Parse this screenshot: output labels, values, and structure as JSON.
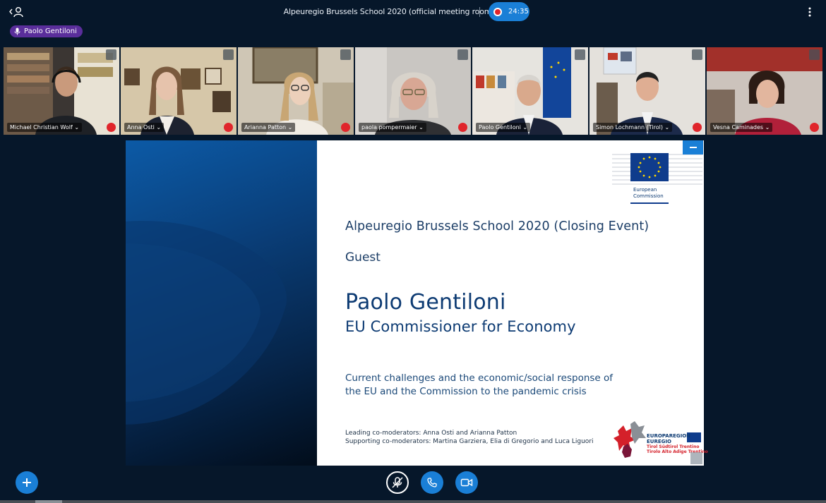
{
  "meeting": {
    "title": "Alpeuregio Brussels School 2020 (official meeting room)",
    "recording_time": "24:35"
  },
  "talking": {
    "speaker": "Paolo Gentiloni"
  },
  "webcams": [
    {
      "name": "Michael Christian Wolf ⌄",
      "muted": true,
      "active": false
    },
    {
      "name": "Anna Osti ⌄",
      "muted": true,
      "active": false
    },
    {
      "name": "Arianna Patton ⌄",
      "muted": true,
      "active": false
    },
    {
      "name": "paola pompermaier ⌄",
      "muted": true,
      "active": false
    },
    {
      "name": "Paolo Gentiloni ⌄",
      "muted": false,
      "active": true
    },
    {
      "name": "Simon Lochmann (Tirol) ⌄",
      "muted": true,
      "active": false
    },
    {
      "name": "Vesna Caminades ⌄",
      "muted": true,
      "active": false
    }
  ],
  "slide": {
    "logo_label_1": "European",
    "logo_label_2": "Commission",
    "event": "Alpeuregio Brussels School 2020 (Closing Event)",
    "guest_label": "Guest",
    "guest_name": "Paolo Gentiloni",
    "guest_role": "EU Commissioner for Economy",
    "description_line1": "Current challenges and the economic/social response of",
    "description_line2": "the EU and the Commission to the pandemic crisis",
    "leading": "Leading co-moderators: Anna Osti and Arianna Patton",
    "supporting": "Supporting co-moderators: Martina Garziera, Elia di Gregorio and Luca Liguori",
    "euregio_1": "EUROPAREGION",
    "euregio_2": "EUREGIO",
    "euregio_3": "Tirol Südtirol Trentino",
    "euregio_4": "Tirolo Alto Adige Trentino"
  },
  "colors": {
    "background": "#06172a",
    "accent": "#1a7fd6",
    "talking_pill": "#5a2e9b",
    "mute_red": "#e0252b"
  },
  "icons": {
    "users": "user-list-icon",
    "options": "kebab-menu-icon",
    "actions": "plus-icon",
    "mic": "microphone-muted-icon",
    "audio": "phone-icon",
    "video": "camera-icon"
  }
}
